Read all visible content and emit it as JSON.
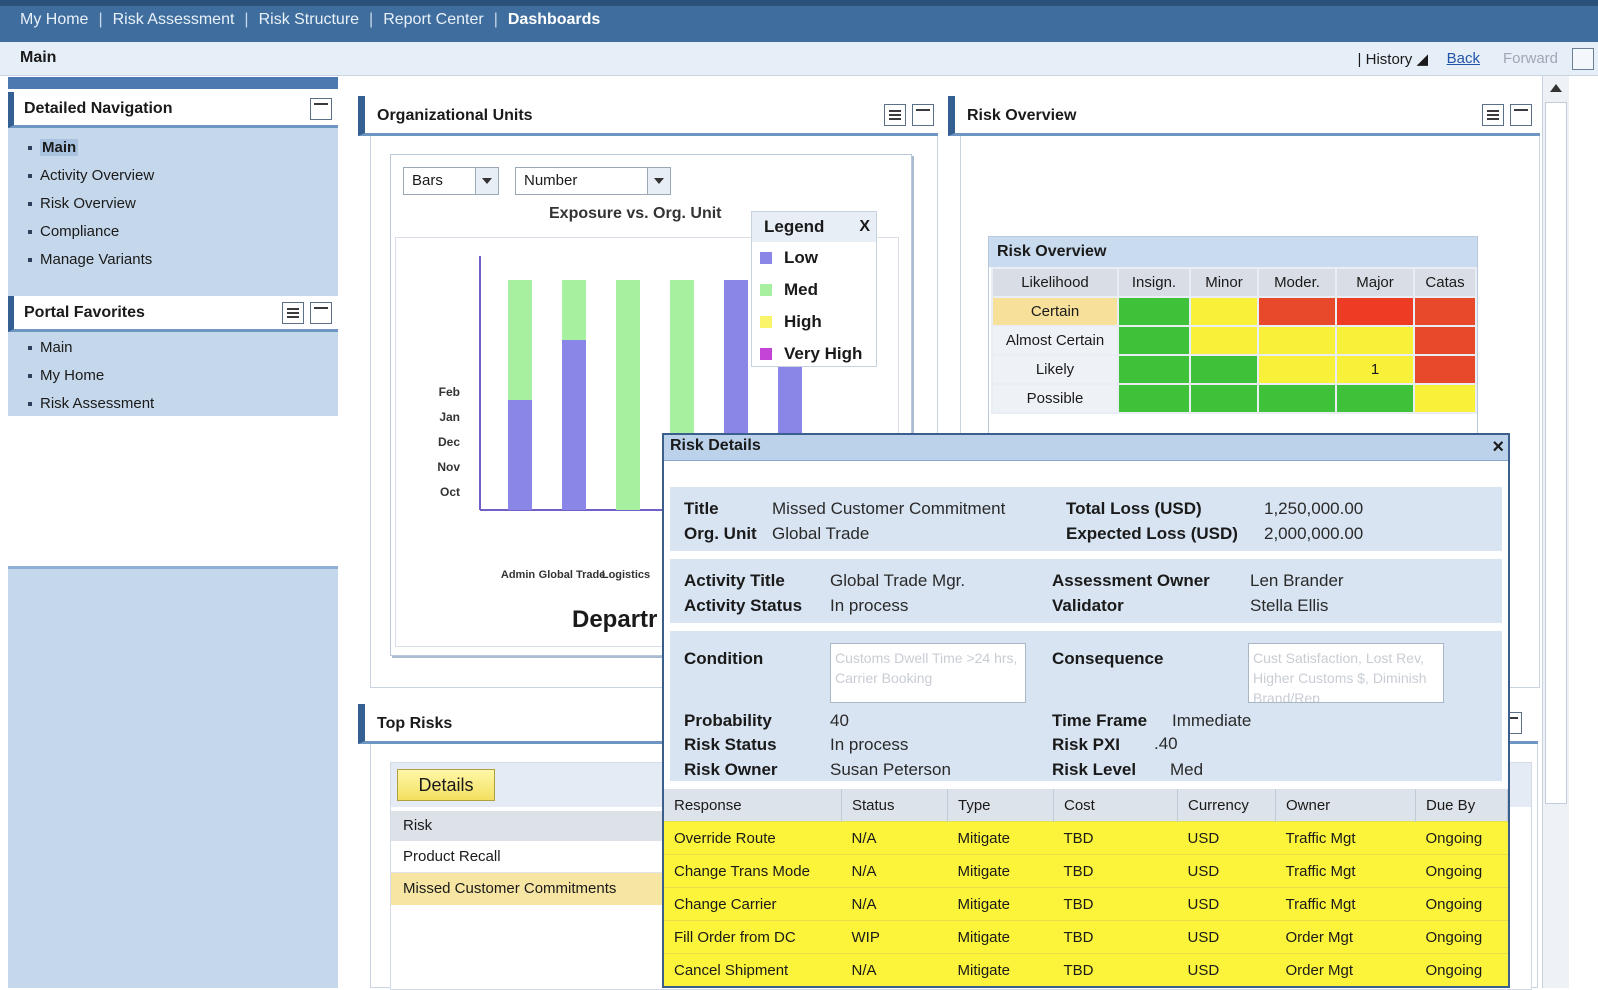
{
  "topnav": {
    "tabs": [
      {
        "label": "My Home"
      },
      {
        "label": "Risk Assessment"
      },
      {
        "label": "Risk Structure"
      },
      {
        "label": "Report Center"
      },
      {
        "label": "Dashboards"
      }
    ]
  },
  "subbar": {
    "crumb": "Main",
    "history": "History",
    "back": "Back",
    "forward": "Forward"
  },
  "detailed_nav": {
    "title": "Detailed Navigation",
    "items": [
      "Main",
      "Activity Overview",
      "Risk Overview",
      "Compliance",
      "Manage Variants"
    ]
  },
  "portal_favorites": {
    "title": "Portal Favorites",
    "items": [
      "Main",
      "My Home",
      "Risk Assessment"
    ]
  },
  "org_units": {
    "title": "Organizational Units",
    "chart_type_select": "Bars",
    "measure_select": "Number",
    "legend": {
      "title": "Legend",
      "close": "X",
      "items": [
        {
          "label": "Low",
          "color": "#8a86e8"
        },
        {
          "label": "Med",
          "color": "#a6f0a0"
        },
        {
          "label": "High",
          "color": "#f9f56a"
        },
        {
          "label": "Very High",
          "color": "#c444d8"
        }
      ]
    },
    "axis_title": "Departr"
  },
  "chart_data": {
    "type": "bar",
    "title": "Exposure vs. Org. Unit",
    "y_tick_labels": [
      "Oct",
      "Nov",
      "Dec",
      "Jan",
      "Feb"
    ],
    "x_tick_labels": [
      "Admin",
      "Global Trade",
      "Logistics"
    ],
    "series": [
      {
        "name": "Low"
      },
      {
        "name": "Med"
      }
    ],
    "bars": [
      {
        "low": 2.2,
        "med": 2.4
      },
      {
        "low": 3.4,
        "med": 1.2
      },
      {
        "low": 0,
        "med": 4.6
      },
      {
        "low": 0,
        "med": 4.6
      },
      {
        "low": 4.6,
        "med": 0
      },
      {
        "low": 4.6,
        "med": 0
      }
    ],
    "ylim": [
      0,
      5
    ]
  },
  "risk_overview_panel": {
    "title": "Risk Overview"
  },
  "risk_matrix": {
    "title": "Risk Overview",
    "columns": [
      "Likelihood",
      "Insign.",
      "Minor",
      "Moder.",
      "Major",
      "Catas"
    ],
    "rows": [
      {
        "label": "Certain",
        "cells": [
          "g",
          "y",
          "r",
          "rr",
          "r"
        ],
        "marks": [
          "",
          "",
          "",
          "",
          ""
        ]
      },
      {
        "label": "Almost Certain",
        "cells": [
          "g",
          "y",
          "y",
          "y",
          "r"
        ],
        "marks": [
          "",
          "",
          "",
          "",
          ""
        ]
      },
      {
        "label": "Likely",
        "cells": [
          "g",
          "g",
          "y",
          "y",
          "r"
        ],
        "marks": [
          "",
          "",
          "",
          "1",
          ""
        ]
      },
      {
        "label": "Possible",
        "cells": [
          "g",
          "g",
          "g",
          "g",
          "y"
        ],
        "marks": [
          "",
          "",
          "",
          "",
          ""
        ]
      }
    ]
  },
  "risk_details": {
    "title": "Risk Details",
    "close": "×",
    "title_label": "Title",
    "title_value": "Missed Customer Commitment",
    "org_label": "Org. Unit",
    "org_value": "Global Trade",
    "total_loss_label": "Total Loss (USD)",
    "total_loss_value": "1,250,000.00",
    "expected_loss_label": "Expected Loss (USD)",
    "expected_loss_value": "2,000,000.00",
    "activity_title_label": "Activity Title",
    "activity_title_value": "Global Trade Mgr.",
    "activity_status_label": "Activity Status",
    "activity_status_value": "In process",
    "assessment_owner_label": "Assessment Owner",
    "assessment_owner_value": "Len Brander",
    "validator_label": "Validator",
    "validator_value": "Stella Ellis",
    "condition_label": "Condition",
    "condition_value": "Customs Dwell Time >24 hrs, Carrier Booking",
    "consequence_label": "Consequence",
    "consequence_value": "Cust Satisfaction, Lost Rev, Higher Customs $, Diminish Brand/Rep",
    "probability_label": "Probability",
    "probability_value": "40",
    "risk_status_label": "Risk Status",
    "risk_status_value": "In process",
    "risk_owner_label": "Risk Owner",
    "risk_owner_value": "Susan Peterson",
    "time_frame_label": "Time Frame",
    "time_frame_value": "Immediate",
    "risk_pxi_label": "Risk PXI",
    "risk_pxi_value": ".40",
    "risk_level_label": "Risk Level",
    "risk_level_value": "Med",
    "responses": {
      "columns": [
        "Response",
        "Status",
        "Type",
        "Cost",
        "Currency",
        "Owner",
        "Due By"
      ],
      "rows": [
        [
          "Override Route",
          "N/A",
          "Mitigate",
          "TBD",
          "USD",
          "Traffic Mgt",
          "Ongoing"
        ],
        [
          "Change Trans Mode",
          "N/A",
          "Mitigate",
          "TBD",
          "USD",
          "Traffic Mgt",
          "Ongoing"
        ],
        [
          "Change Carrier",
          "N/A",
          "Mitigate",
          "TBD",
          "USD",
          "Traffic Mgt",
          "Ongoing"
        ],
        [
          "Fill Order from DC",
          "WIP",
          "Mitigate",
          "TBD",
          "USD",
          "Order Mgt",
          "Ongoing"
        ],
        [
          "Cancel Shipment",
          "N/A",
          "Mitigate",
          "TBD",
          "USD",
          "Order Mgt",
          "Ongoing"
        ]
      ]
    }
  },
  "top_risks": {
    "title": "Top Risks",
    "details_button": "Details",
    "column": "Risk",
    "rows": [
      "Product Recall",
      "Missed Customer Commitments"
    ]
  },
  "colors": {
    "nav_bg": "#3f6e9e",
    "panel_accent": "#345f92",
    "side_bg": "#c5d7ea",
    "highlight_row": "#f7e09a"
  }
}
